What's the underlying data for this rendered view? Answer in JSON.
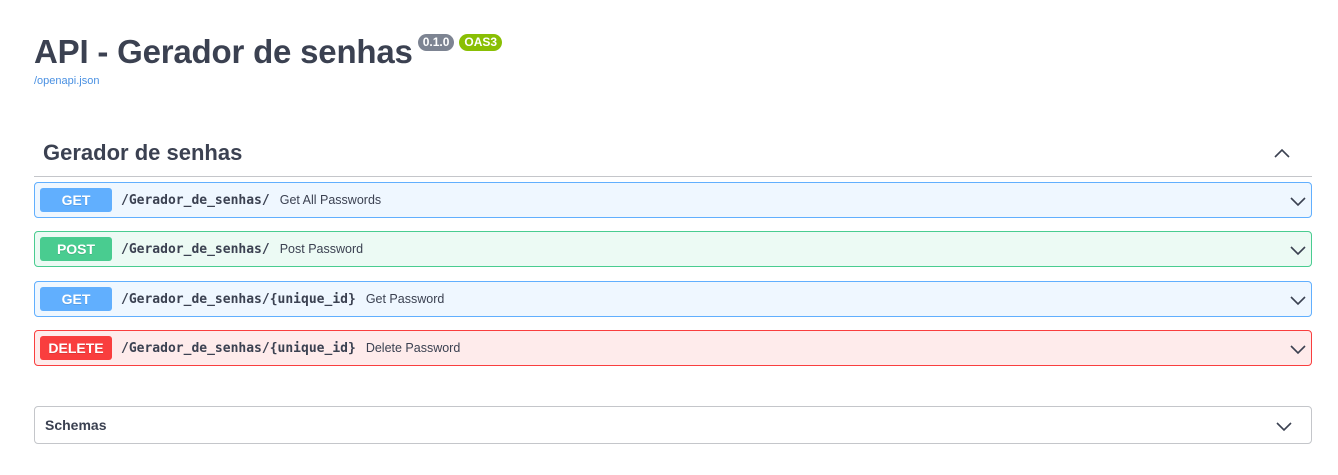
{
  "header": {
    "title": "API - Gerador de senhas",
    "version_badge": "0.1.0",
    "oas_badge": "OAS3",
    "spec_link": "/openapi.json"
  },
  "tag": {
    "title": "Gerador de senhas",
    "toggle_icon": "chevron-up-icon"
  },
  "operations": [
    {
      "method": "GET",
      "path": "/Gerador_de_senhas/",
      "summary": "Get All Passwords",
      "color": "#61affe"
    },
    {
      "method": "POST",
      "path": "/Gerador_de_senhas/",
      "summary": "Post Password",
      "color": "#49cc90"
    },
    {
      "method": "GET",
      "path": "/Gerador_de_senhas/{unique_id}",
      "summary": "Get Password",
      "color": "#61affe"
    },
    {
      "method": "DELETE",
      "path": "/Gerador_de_senhas/{unique_id}",
      "summary": "Delete Password",
      "color": "#f93e3e"
    }
  ],
  "schemas": {
    "title": "Schemas",
    "toggle_icon": "chevron-down-icon"
  }
}
